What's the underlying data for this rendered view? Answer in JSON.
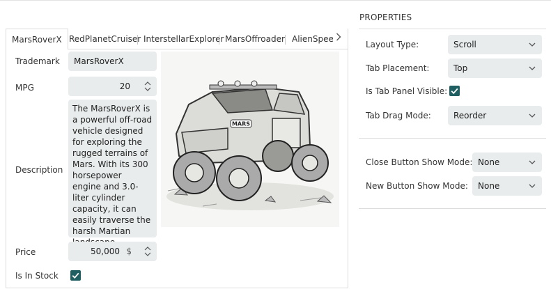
{
  "tabs": [
    {
      "label": "MarsRoverX",
      "active": true
    },
    {
      "label": "RedPlanetCruiser"
    },
    {
      "label": "InterstellarExplorer"
    },
    {
      "label": "MarsOffroader"
    },
    {
      "label": "AlienSpee"
    }
  ],
  "form": {
    "trademark_label": "Trademark",
    "trademark_value": "MarsRoverX",
    "mpg_label": "MPG",
    "mpg_value": "20",
    "description_label": "Description",
    "description_value": "The MarsRoverX is a powerful off-road vehicle designed for exploring the rugged terrains of Mars. With its 300 horsepower engine and 3.0-liter cylinder capacity, it can easily traverse the harsh Martian landscape.",
    "price_label": "Price",
    "price_value": "50,000",
    "price_currency": "$",
    "in_stock_label": "Is In Stock",
    "in_stock_checked": true,
    "image_badge": "MARS"
  },
  "properties": {
    "title": "PROPERTIES",
    "layout_type_label": "Layout Type:",
    "layout_type_value": "Scroll",
    "tab_placement_label": "Tab Placement:",
    "tab_placement_value": "Top",
    "tab_panel_visible_label": "Is Tab Panel Visible:",
    "tab_panel_visible_checked": true,
    "tab_drag_mode_label": "Tab Drag Mode:",
    "tab_drag_mode_value": "Reorder",
    "close_button_label": "Close Button Show Mode:",
    "close_button_value": "None",
    "new_button_label": "New Button Show Mode:",
    "new_button_value": "None"
  },
  "colors": {
    "accent": "#1f5f61",
    "field_bg": "#e8ecec",
    "border": "#dcdcdc"
  }
}
